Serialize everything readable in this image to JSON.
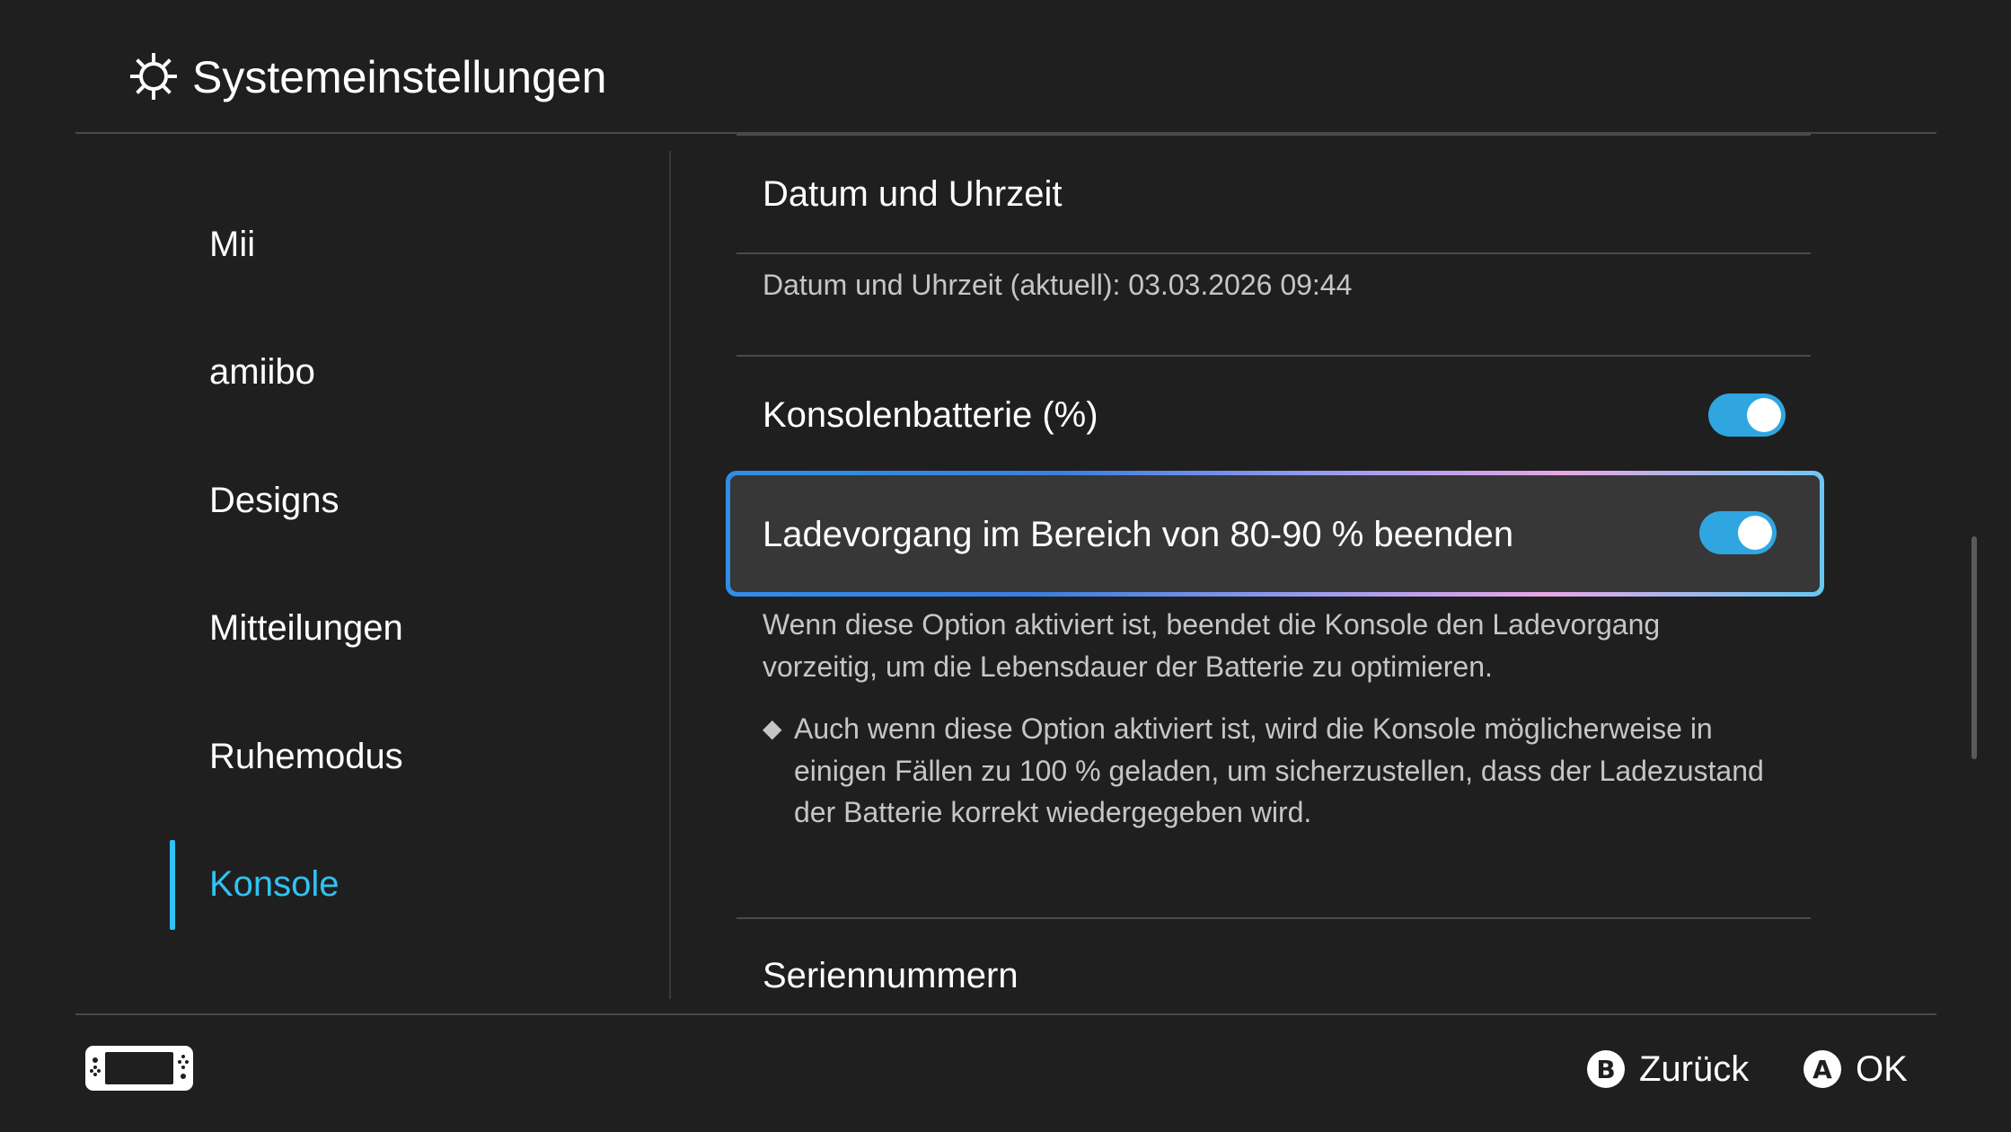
{
  "header": {
    "title": "Systemeinstellungen",
    "icon": "gear-icon"
  },
  "sidebar": {
    "items": [
      {
        "label": "Mii",
        "active": false
      },
      {
        "label": "amiibo",
        "active": false
      },
      {
        "label": "Designs",
        "active": false
      },
      {
        "label": "Mitteilungen",
        "active": false
      },
      {
        "label": "Ruhemodus",
        "active": false
      },
      {
        "label": "Konsole",
        "active": true
      }
    ],
    "accent_color": "#2fc3f3"
  },
  "content": {
    "datetime_title": "Datum und Uhrzeit",
    "datetime_info": "Datum und Uhrzeit (aktuell): 03.03.2026 09:44",
    "battery_percent": {
      "label": "Konsolenbatterie (%)",
      "enabled": true
    },
    "charge_limit": {
      "label": "Ladevorgang im Bereich von 80-90 % beenden",
      "enabled": true
    },
    "description_lines": [
      "Wenn diese Option aktiviert ist, beendet die Konsole den Ladevorgang",
      "vorzeitig, um die Lebensdauer der Batterie zu optimieren."
    ],
    "note_bullet": "◆",
    "note_lines": [
      "Auch wenn diese Option aktiviert ist, wird die Konsole möglicherweise in",
      "einigen Fällen zu 100 % geladen, um sicherzustellen, dass der Ladezustand",
      "der Batterie korrekt wiedergegeben wird."
    ],
    "serial_title": "Seriennummern"
  },
  "footer": {
    "console_icon": "console-icon",
    "back": {
      "button": "B",
      "label": "Zurück"
    },
    "ok": {
      "button": "A",
      "label": "OK"
    }
  },
  "colors": {
    "background": "#1f1f1f",
    "toggle_on": "#2fa6e0",
    "focused_row": "#373737"
  }
}
